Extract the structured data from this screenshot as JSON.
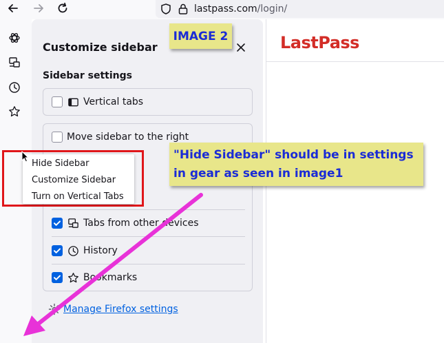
{
  "toolbar": {
    "back_icon": "arrow-left-icon",
    "forward_icon": "arrow-right-icon",
    "reload_icon": "reload-icon",
    "url_host": "lastpass.com",
    "url_path": "/login/"
  },
  "sidebar_strip": {
    "icons": [
      "ai-chatbot-icon",
      "synced-tabs-icon",
      "history-icon",
      "bookmarks-icon"
    ]
  },
  "panel": {
    "title": "Customize sidebar",
    "section_heading": "Sidebar settings",
    "vertical_tabs_label": "Vertical tabs",
    "move_sidebar_label": "Move sidebar to the right",
    "tools": [
      {
        "label": "Tabs from other devices",
        "checked": true,
        "icon": "synced-tabs-icon"
      },
      {
        "label": "History",
        "checked": true,
        "icon": "history-icon"
      },
      {
        "label": "Bookmarks",
        "checked": true,
        "icon": "bookmarks-icon"
      }
    ],
    "manage_settings_label": "Manage Firefox settings"
  },
  "context_menu": {
    "items": [
      "Hide Sidebar",
      "Customize Sidebar",
      "Turn on Vertical Tabs"
    ]
  },
  "content": {
    "logo_text": "LastPass"
  },
  "annotations": {
    "image_label": "IMAGE 2",
    "note_line1": "\"Hide Sidebar\" should be in settings",
    "note_line2": "in gear as seen in image1",
    "highlight_color": "#e0161a",
    "arrow_color": "#e832d8",
    "note_background": "#e8e68a"
  }
}
